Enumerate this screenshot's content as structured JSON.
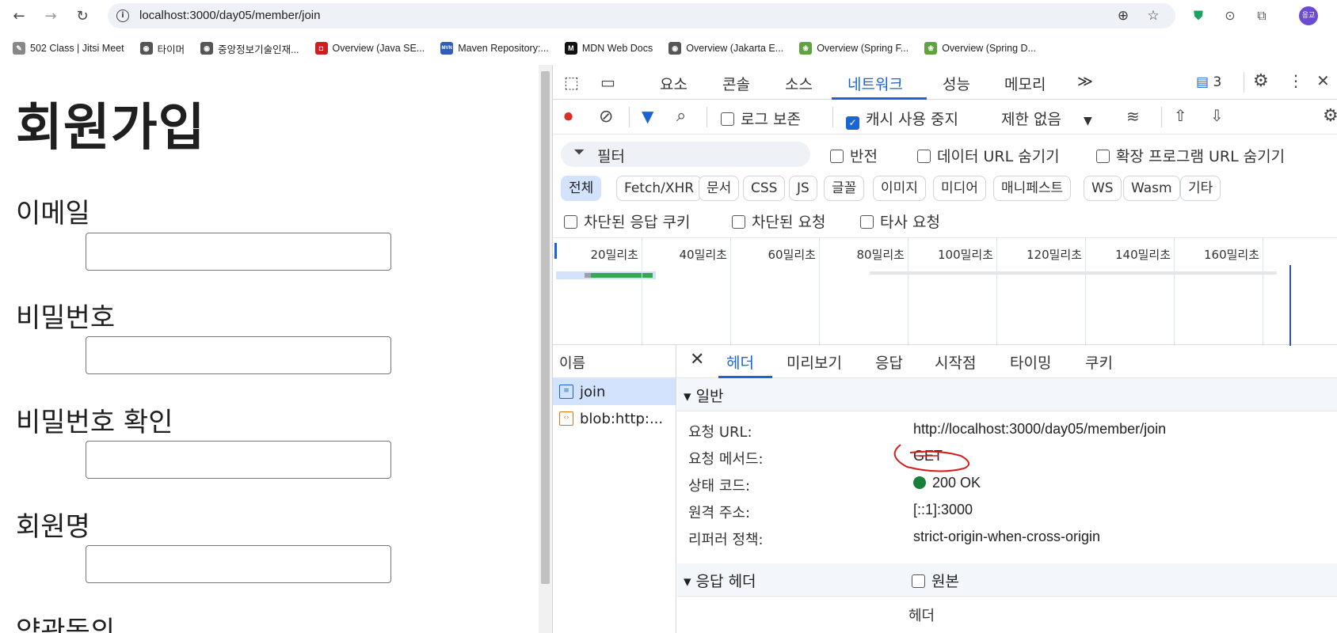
{
  "browser": {
    "url": "localhost:3000/day05/member/join",
    "bookmarks": [
      {
        "label": "502 Class | Jitsi Meet",
        "color": "#888888",
        "glyph": "✎"
      },
      {
        "label": "타이머",
        "color": "#555555",
        "glyph": "◉"
      },
      {
        "label": "중앙정보기술인재...",
        "color": "#555555",
        "glyph": "◉"
      },
      {
        "label": "Overview (Java SE...",
        "color": "#cc1f1f",
        "glyph": "◘"
      },
      {
        "label": "Maven Repository:...",
        "color": "#2f5db8",
        "glyph": "MVN"
      },
      {
        "label": "MDN Web Docs",
        "color": "#111111",
        "glyph": "M"
      },
      {
        "label": "Overview (Jakarta E...",
        "color": "#555555",
        "glyph": "◉"
      },
      {
        "label": "Overview (Spring F...",
        "color": "#5fa23f",
        "glyph": "❀"
      },
      {
        "label": "Overview (Spring D...",
        "color": "#5fa23f",
        "glyph": "❀"
      }
    ],
    "avatar_text": "응교"
  },
  "page": {
    "title": "회원가입",
    "fields": [
      {
        "label": "이메일"
      },
      {
        "label": "비밀번호"
      },
      {
        "label": "비밀번호 확인"
      },
      {
        "label": "회원명"
      },
      {
        "label": "약관동의"
      }
    ]
  },
  "devtools": {
    "tabs": [
      "요소",
      "콘솔",
      "소스",
      "네트워크",
      "성능",
      "메모리"
    ],
    "active_tab": "네트워크",
    "more_label": "≫",
    "issues_count": "3",
    "toolbar": {
      "preserve_log": "로그 보존",
      "disable_cache": "캐시 사용 중지",
      "throttle": "제한 없음"
    },
    "filter": {
      "placeholder": "필터",
      "invert": "반전",
      "hide_data_urls": "데이터 URL 숨기기",
      "hide_ext_urls": "확장 프로그램 URL 숨기기"
    },
    "type_filters": [
      "전체",
      "Fetch/XHR",
      "문서",
      "CSS",
      "JS",
      "글꼴",
      "이미지",
      "미디어",
      "매니페스트",
      "WS",
      "Wasm",
      "기타"
    ],
    "row3": {
      "blocked_cookies": "차단된 응답 쿠키",
      "blocked_requests": "차단된 요청",
      "third_party": "타사 요청"
    },
    "timeline_ticks": [
      "20밀리초",
      "40밀리초",
      "60밀리초",
      "80밀리초",
      "100밀리초",
      "120밀리초",
      "140밀리초",
      "160밀리초"
    ],
    "names_header": "이름",
    "requests": [
      {
        "name": "join",
        "selected": true
      },
      {
        "name": "blob:http:...",
        "selected": false
      }
    ],
    "detail_tabs": [
      "헤더",
      "미리보기",
      "응답",
      "시작점",
      "타이밍",
      "쿠키"
    ],
    "general_section": "▾ 일반",
    "general": [
      {
        "key": "요청 URL:",
        "value": "http://localhost:3000/day05/member/join"
      },
      {
        "key": "요청 메서드:",
        "value": "GET"
      },
      {
        "key": "상태 코드:",
        "value": "200 OK"
      },
      {
        "key": "원격 주소:",
        "value": "[::1]:3000"
      },
      {
        "key": "리퍼러 정책:",
        "value": "strict-origin-when-cross-origin"
      }
    ],
    "response_headers_section": "▾ 응답 헤더",
    "raw_label": "원본",
    "headers_col": "헤더"
  }
}
